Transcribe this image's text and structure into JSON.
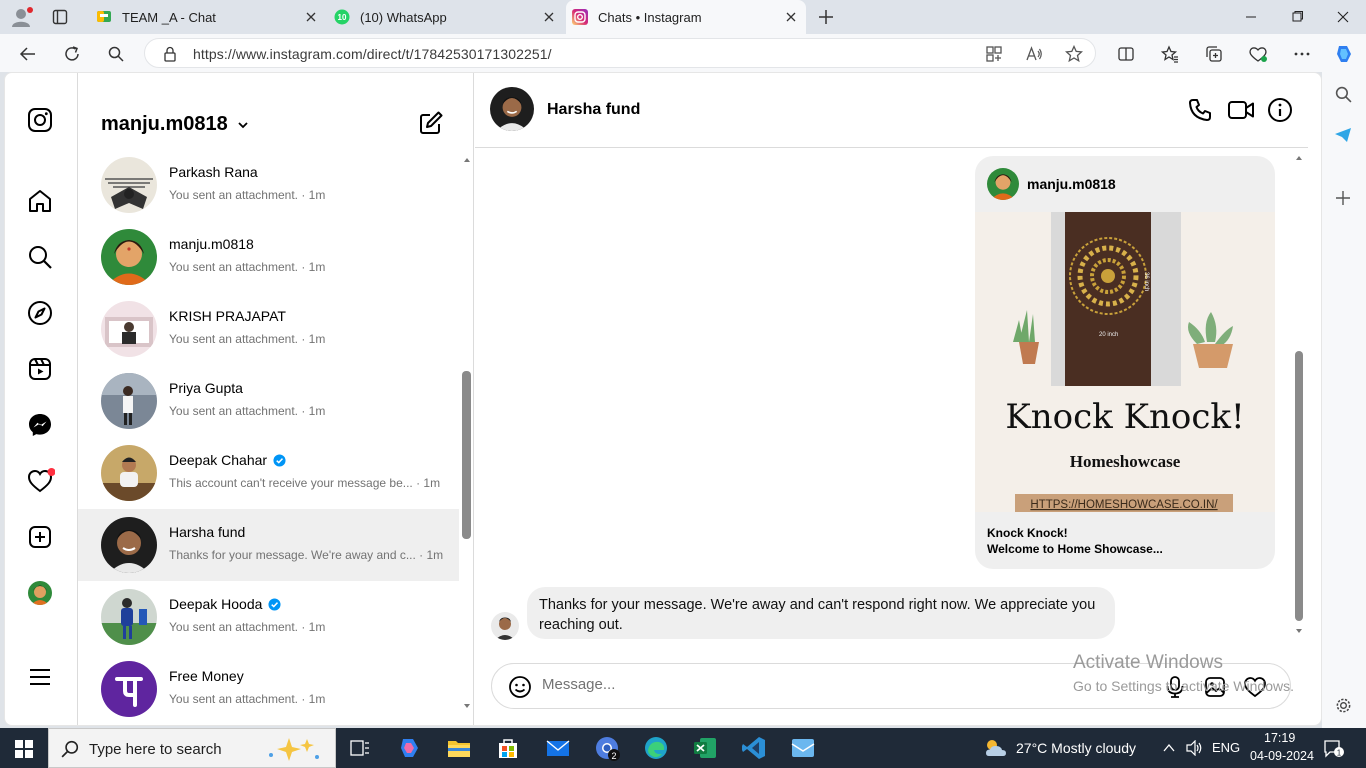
{
  "browser": {
    "tabs": [
      {
        "title": "TEAM _A - Chat",
        "icon": "google-chat-icon"
      },
      {
        "title": "(10) WhatsApp",
        "icon": "whatsapp-icon",
        "badge": "10"
      },
      {
        "title": "Chats • Instagram",
        "icon": "instagram-icon",
        "active": true
      }
    ],
    "url": "https://www.instagram.com/direct/t/17842530171302251/"
  },
  "inbox": {
    "username": "manju.m0818",
    "conversations": [
      {
        "name": "Parkash Rana",
        "preview": "You sent an attachment. · 1m",
        "verified": false
      },
      {
        "name": "manju.m0818",
        "preview": "You sent an attachment. · 1m",
        "verified": false
      },
      {
        "name": "KRISH PRAJAPAT",
        "preview": "You sent an attachment. · 1m",
        "verified": false
      },
      {
        "name": "Priya Gupta",
        "preview": "You sent an attachment. · 1m",
        "verified": false
      },
      {
        "name": "Deepak Chahar",
        "preview": "This account can't receive your message be...  · 1m",
        "verified": true
      },
      {
        "name": "Harsha fund",
        "preview": "Thanks for your message. We're away and c...  · 1m",
        "verified": false,
        "active": true
      },
      {
        "name": "Deepak Hooda",
        "preview": "You sent an attachment. · 1m",
        "verified": true
      },
      {
        "name": "Free Money",
        "preview": "You sent an attachment. · 1m",
        "verified": false
      }
    ]
  },
  "chat": {
    "name": "Harsha fund",
    "shared_post": {
      "user": "manju.m0818",
      "headline": "Knock Knock!",
      "brand": "Homeshowcase",
      "link": "HTTPS://HOMESHOWCASE.CO.IN/",
      "dim_height": "36 inch",
      "dim_width": "20 inch",
      "caption_line1": "Knock Knock!",
      "caption_line2": "Welcome to Home Showcase..."
    },
    "message": "Thanks for your message. We're away and can't respond right now. We appreciate you reaching out.",
    "composer_placeholder": "Message..."
  },
  "watermark": {
    "line1": "Activate Windows",
    "line2": "Go to Settings to activate Windows."
  },
  "taskbar": {
    "search_placeholder": "Type here to search",
    "weather": "27°C  Mostly cloudy",
    "language": "ENG",
    "time": "17:19",
    "date": "04-09-2024",
    "edge_badge": "2",
    "notification_count": "1"
  },
  "colors": {
    "accent_blue": "#0095f6",
    "verified_blue": "#0095f6",
    "notification_red": "#ff3040",
    "free_money_purple": "#5f259f"
  }
}
